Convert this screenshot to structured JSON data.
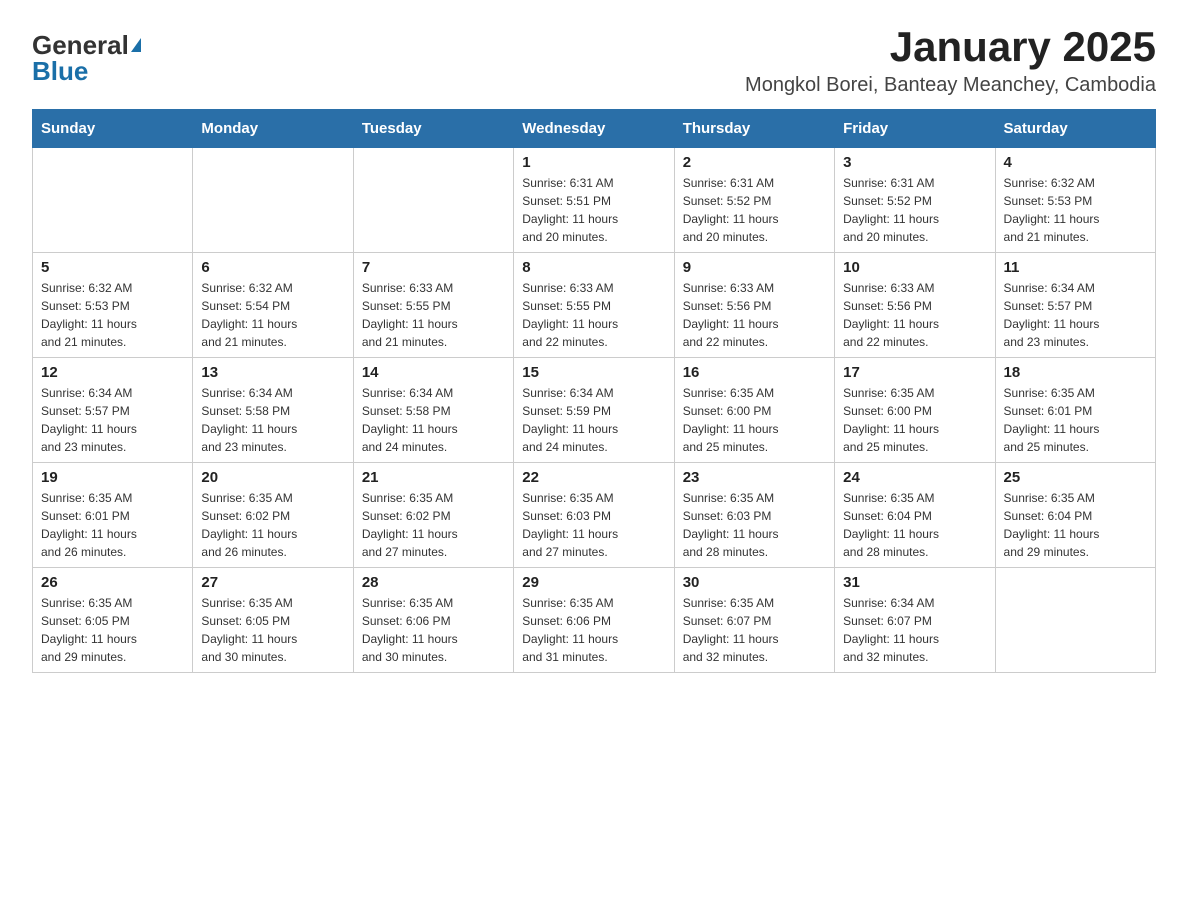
{
  "header": {
    "logo_general": "General",
    "logo_blue": "Blue",
    "month_year": "January 2025",
    "location": "Mongkol Borei, Banteay Meanchey, Cambodia"
  },
  "weekdays": [
    "Sunday",
    "Monday",
    "Tuesday",
    "Wednesday",
    "Thursday",
    "Friday",
    "Saturday"
  ],
  "weeks": [
    [
      {
        "day": "",
        "info": ""
      },
      {
        "day": "",
        "info": ""
      },
      {
        "day": "",
        "info": ""
      },
      {
        "day": "1",
        "info": "Sunrise: 6:31 AM\nSunset: 5:51 PM\nDaylight: 11 hours\nand 20 minutes."
      },
      {
        "day": "2",
        "info": "Sunrise: 6:31 AM\nSunset: 5:52 PM\nDaylight: 11 hours\nand 20 minutes."
      },
      {
        "day": "3",
        "info": "Sunrise: 6:31 AM\nSunset: 5:52 PM\nDaylight: 11 hours\nand 20 minutes."
      },
      {
        "day": "4",
        "info": "Sunrise: 6:32 AM\nSunset: 5:53 PM\nDaylight: 11 hours\nand 21 minutes."
      }
    ],
    [
      {
        "day": "5",
        "info": "Sunrise: 6:32 AM\nSunset: 5:53 PM\nDaylight: 11 hours\nand 21 minutes."
      },
      {
        "day": "6",
        "info": "Sunrise: 6:32 AM\nSunset: 5:54 PM\nDaylight: 11 hours\nand 21 minutes."
      },
      {
        "day": "7",
        "info": "Sunrise: 6:33 AM\nSunset: 5:55 PM\nDaylight: 11 hours\nand 21 minutes."
      },
      {
        "day": "8",
        "info": "Sunrise: 6:33 AM\nSunset: 5:55 PM\nDaylight: 11 hours\nand 22 minutes."
      },
      {
        "day": "9",
        "info": "Sunrise: 6:33 AM\nSunset: 5:56 PM\nDaylight: 11 hours\nand 22 minutes."
      },
      {
        "day": "10",
        "info": "Sunrise: 6:33 AM\nSunset: 5:56 PM\nDaylight: 11 hours\nand 22 minutes."
      },
      {
        "day": "11",
        "info": "Sunrise: 6:34 AM\nSunset: 5:57 PM\nDaylight: 11 hours\nand 23 minutes."
      }
    ],
    [
      {
        "day": "12",
        "info": "Sunrise: 6:34 AM\nSunset: 5:57 PM\nDaylight: 11 hours\nand 23 minutes."
      },
      {
        "day": "13",
        "info": "Sunrise: 6:34 AM\nSunset: 5:58 PM\nDaylight: 11 hours\nand 23 minutes."
      },
      {
        "day": "14",
        "info": "Sunrise: 6:34 AM\nSunset: 5:58 PM\nDaylight: 11 hours\nand 24 minutes."
      },
      {
        "day": "15",
        "info": "Sunrise: 6:34 AM\nSunset: 5:59 PM\nDaylight: 11 hours\nand 24 minutes."
      },
      {
        "day": "16",
        "info": "Sunrise: 6:35 AM\nSunset: 6:00 PM\nDaylight: 11 hours\nand 25 minutes."
      },
      {
        "day": "17",
        "info": "Sunrise: 6:35 AM\nSunset: 6:00 PM\nDaylight: 11 hours\nand 25 minutes."
      },
      {
        "day": "18",
        "info": "Sunrise: 6:35 AM\nSunset: 6:01 PM\nDaylight: 11 hours\nand 25 minutes."
      }
    ],
    [
      {
        "day": "19",
        "info": "Sunrise: 6:35 AM\nSunset: 6:01 PM\nDaylight: 11 hours\nand 26 minutes."
      },
      {
        "day": "20",
        "info": "Sunrise: 6:35 AM\nSunset: 6:02 PM\nDaylight: 11 hours\nand 26 minutes."
      },
      {
        "day": "21",
        "info": "Sunrise: 6:35 AM\nSunset: 6:02 PM\nDaylight: 11 hours\nand 27 minutes."
      },
      {
        "day": "22",
        "info": "Sunrise: 6:35 AM\nSunset: 6:03 PM\nDaylight: 11 hours\nand 27 minutes."
      },
      {
        "day": "23",
        "info": "Sunrise: 6:35 AM\nSunset: 6:03 PM\nDaylight: 11 hours\nand 28 minutes."
      },
      {
        "day": "24",
        "info": "Sunrise: 6:35 AM\nSunset: 6:04 PM\nDaylight: 11 hours\nand 28 minutes."
      },
      {
        "day": "25",
        "info": "Sunrise: 6:35 AM\nSunset: 6:04 PM\nDaylight: 11 hours\nand 29 minutes."
      }
    ],
    [
      {
        "day": "26",
        "info": "Sunrise: 6:35 AM\nSunset: 6:05 PM\nDaylight: 11 hours\nand 29 minutes."
      },
      {
        "day": "27",
        "info": "Sunrise: 6:35 AM\nSunset: 6:05 PM\nDaylight: 11 hours\nand 30 minutes."
      },
      {
        "day": "28",
        "info": "Sunrise: 6:35 AM\nSunset: 6:06 PM\nDaylight: 11 hours\nand 30 minutes."
      },
      {
        "day": "29",
        "info": "Sunrise: 6:35 AM\nSunset: 6:06 PM\nDaylight: 11 hours\nand 31 minutes."
      },
      {
        "day": "30",
        "info": "Sunrise: 6:35 AM\nSunset: 6:07 PM\nDaylight: 11 hours\nand 32 minutes."
      },
      {
        "day": "31",
        "info": "Sunrise: 6:34 AM\nSunset: 6:07 PM\nDaylight: 11 hours\nand 32 minutes."
      },
      {
        "day": "",
        "info": ""
      }
    ]
  ]
}
